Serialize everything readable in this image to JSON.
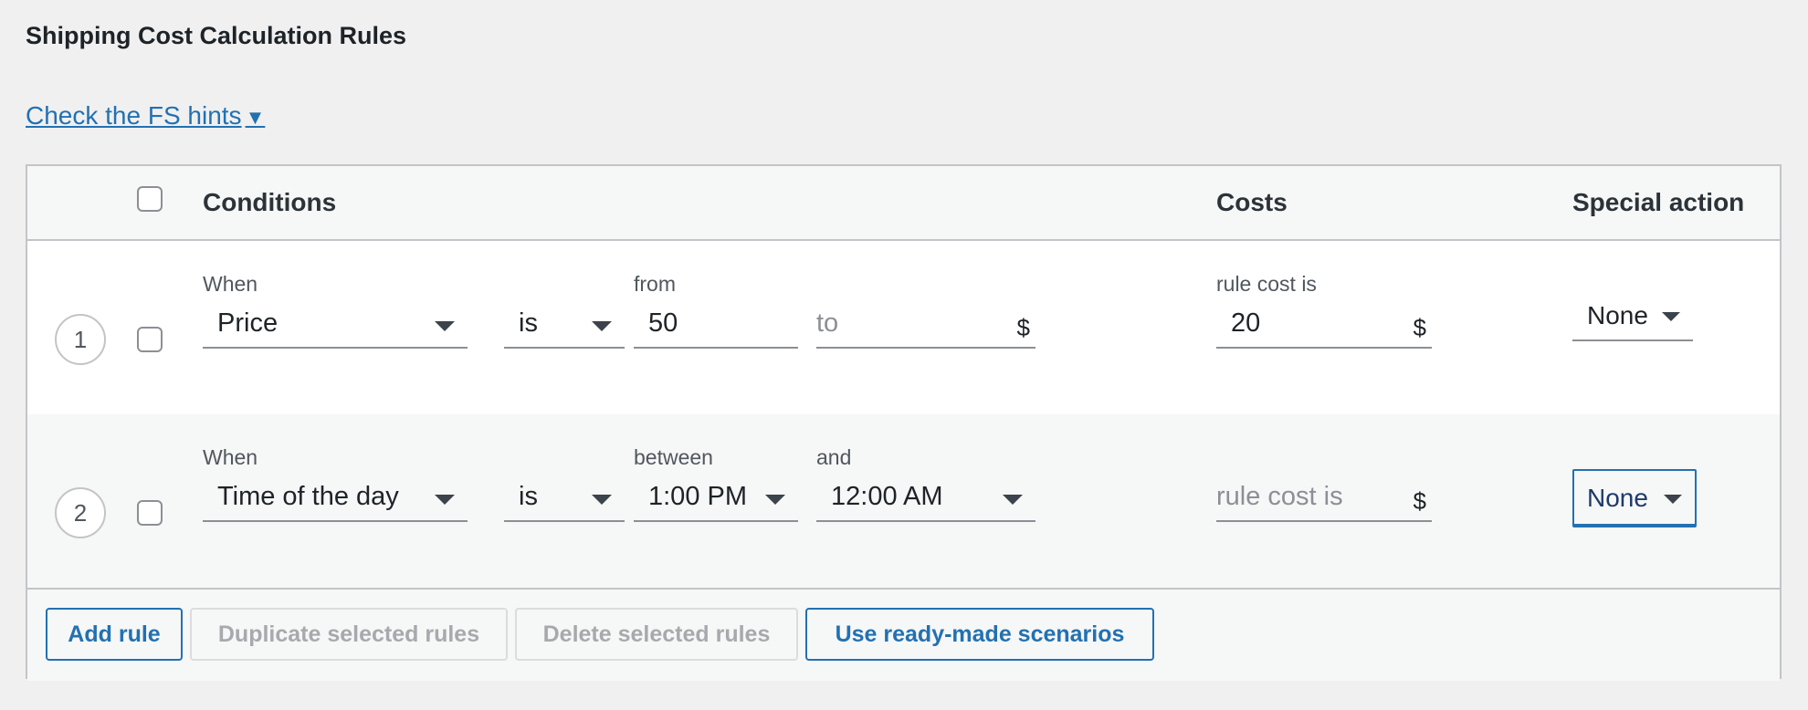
{
  "section": {
    "title": "Shipping Cost Calculation Rules"
  },
  "hints": {
    "link_text": "Check the FS hints",
    "caret": "▼"
  },
  "table": {
    "headers": {
      "conditions": "Conditions",
      "costs": "Costs",
      "special_action": "Special action"
    },
    "rows": [
      {
        "number": "1",
        "when_label": "When",
        "condition": "Price",
        "operator": "is",
        "from_label": "from",
        "from_value": "50",
        "to_placeholder": "to",
        "to_unit": "$",
        "cost_label": "rule cost is",
        "cost_value": "20",
        "cost_unit": "$",
        "special_action": "None"
      },
      {
        "number": "2",
        "when_label": "When",
        "condition": "Time of the day",
        "operator": "is",
        "between_label": "between",
        "between_value": "1:00 PM",
        "and_label": "and",
        "and_value": "12:00 AM",
        "cost_placeholder": "rule cost is",
        "cost_unit": "$",
        "special_action": "None"
      }
    ]
  },
  "footer": {
    "add_rule": "Add rule",
    "duplicate": "Duplicate selected rules",
    "delete": "Delete selected rules",
    "scenarios": "Use ready-made scenarios"
  }
}
